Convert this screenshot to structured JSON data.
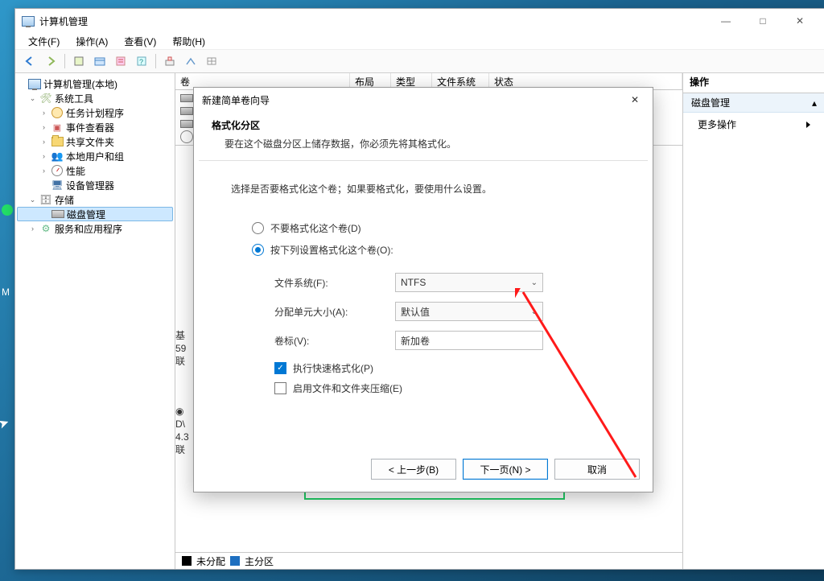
{
  "desktop": {
    "label_behind": "M"
  },
  "titlebar": {
    "title": "计算机管理"
  },
  "window_controls": {
    "min": "—",
    "max": "□",
    "close": "✕"
  },
  "menubar": {
    "file": "文件(F)",
    "action": "操作(A)",
    "view": "查看(V)",
    "help": "帮助(H)"
  },
  "tree": {
    "root": "计算机管理(本地)",
    "system_tools": "系统工具",
    "task_scheduler": "任务计划程序",
    "event_viewer": "事件查看器",
    "shared_folders": "共享文件夹",
    "local_users": "本地用户和组",
    "performance": "性能",
    "device_manager": "设备管理器",
    "storage": "存储",
    "disk_management": "磁盘管理",
    "services_apps": "服务和应用程序"
  },
  "columns": {
    "volume": "卷",
    "layout": "布局",
    "type": "类型",
    "fs": "文件系统",
    "status": "状态"
  },
  "disk_panel": {
    "info1_a": "基",
    "info1_b": "59",
    "info1_c": "联",
    "info2_a": "D\\",
    "info2_b": "4.3",
    "info2_c": "联"
  },
  "legend": {
    "unalloc": "未分配",
    "primary": "主分区"
  },
  "actions": {
    "header": "操作",
    "category": "磁盘管理",
    "more": "更多操作"
  },
  "dialog": {
    "title": "新建简单卷向导",
    "heading": "格式化分区",
    "subheading": "要在这个磁盘分区上储存数据，你必须先将其格式化。",
    "prompt": "选择是否要格式化这个卷；如果要格式化，要使用什么设置。",
    "radio_no_format": "不要格式化这个卷(D)",
    "radio_format": "按下列设置格式化这个卷(O):",
    "fs_label": "文件系统(F):",
    "fs_value": "NTFS",
    "alloc_label": "分配单元大小(A):",
    "alloc_value": "默认值",
    "vol_label_label": "卷标(V):",
    "vol_label_value": "新加卷",
    "quick_format": "执行快速格式化(P)",
    "enable_compression": "启用文件和文件夹压缩(E)",
    "back": "< 上一步(B)",
    "next": "下一页(N) >",
    "cancel": "取消",
    "close_x": "✕"
  }
}
